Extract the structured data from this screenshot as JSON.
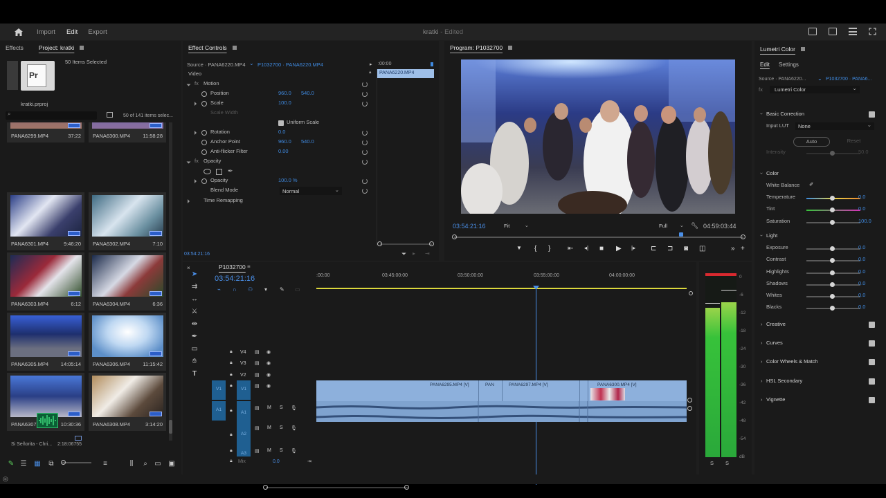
{
  "topbar": {
    "home": "home-icon",
    "nav": [
      "Import",
      "Edit",
      "Export"
    ],
    "active": "Edit",
    "title": "kratki",
    "title_status": "- Edited"
  },
  "project": {
    "tab_effects": "Effects",
    "tab_project": "Project: kratki",
    "selected_info": "50 Items Selected",
    "project_file": "kratki.prproj",
    "items_count": "50 of 141 items selec...",
    "clips": [
      {
        "name": "PANA6299.MP4",
        "dur": "37:22"
      },
      {
        "name": "PANA6300.MP4",
        "dur": "11:58:28"
      },
      {
        "name": "PANA6301.MP4",
        "dur": "9:46:20"
      },
      {
        "name": "PANA6302.MP4",
        "dur": "7:10"
      },
      {
        "name": "PANA6303.MP4",
        "dur": "6:12"
      },
      {
        "name": "PANA6304.MP4",
        "dur": "6:36"
      },
      {
        "name": "PANA6305.MP4",
        "dur": "14:05:14"
      },
      {
        "name": "PANA6306.MP4",
        "dur": "11:15:42"
      },
      {
        "name": "PANA6307.MP4",
        "dur": "10:30:36"
      },
      {
        "name": "PANA6308.MP4",
        "dur": "3:14:20"
      }
    ],
    "audio_clip_name": "Si Señorita - Chri...",
    "audio_clip_dur": "2:18:06755"
  },
  "effect_controls": {
    "tab": "Effect Controls",
    "source": "Source · PANA6220.MP4",
    "sequence": "P1032700 · PANA6220.MP4",
    "time_start": ":00:00",
    "clip_label": "PANA6220.MP4",
    "video_label": "Video",
    "motion": "Motion",
    "position": "Position",
    "position_x": "960.0",
    "position_y": "540.0",
    "scale": "Scale",
    "scale_v": "100.0",
    "scale_width": "Scale Width",
    "uniform_scale": "Uniform Scale",
    "rotation": "Rotation",
    "rotation_v": "0.0",
    "anchor": "Anchor Point",
    "anchor_x": "960.0",
    "anchor_y": "540.0",
    "antiflicker": "Anti-flicker Filter",
    "antiflicker_v": "0.00",
    "opacity_group": "Opacity",
    "opacity": "Opacity",
    "opacity_v": "100.0 %",
    "blend": "Blend Mode",
    "blend_v": "Normal",
    "time_remap": "Time Remapping",
    "timecode": "03:54:21:16"
  },
  "program": {
    "tab": "Program: P1032700",
    "timecode": "03:54:21:16",
    "fit": "Fit",
    "full": "Full",
    "duration": "04:59:03:44"
  },
  "timeline": {
    "tab": "P1032700",
    "timecode": "03:54:21:16",
    "ruler": [
      ":00:00",
      "03:45:00:00",
      "03:50:00:00",
      "03:55:00:00",
      "04:00:00:00"
    ],
    "video_tracks": [
      "V4",
      "V3",
      "V2",
      "V1"
    ],
    "audio_tracks": [
      "A1",
      "A2",
      "A3"
    ],
    "mix": "Mix",
    "mix_v": "0.0",
    "clips": [
      "PANA6295.MP4 [V]",
      "PAN",
      "PANA6297.MP4 [V]",
      "PANA6300.MP4 [V]"
    ]
  },
  "meter": {
    "scale": [
      "0",
      "-6",
      "-12",
      "-18",
      "-24",
      "-30",
      "-36",
      "-42",
      "-48",
      "-54",
      "dB"
    ],
    "solo": [
      "S",
      "S"
    ]
  },
  "lumetri": {
    "tab": "Lumetri Color",
    "tabs": [
      "Edit",
      "Settings"
    ],
    "source": "Source · PANA6220...",
    "sequence": "P1032700 · PANA6...",
    "effect": "Lumetri Color",
    "basic_correction": "Basic Correction",
    "input_lut": "Input LUT",
    "input_lut_v": "None",
    "auto": "Auto",
    "reset": "Reset",
    "intensity": "Intensity",
    "intensity_v": "50.0",
    "color": "Color",
    "white_balance": "White Balance",
    "temperature": "Temperature",
    "temperature_v": "0.0",
    "tint": "Tint",
    "tint_v": "0.0",
    "saturation": "Saturation",
    "saturation_v": "100.0",
    "light": "Light",
    "exposure": "Exposure",
    "exposure_v": "0.0",
    "contrast": "Contrast",
    "contrast_v": "0.0",
    "highlights": "Highlights",
    "highlights_v": "0.0",
    "shadows": "Shadows",
    "shadows_v": "0.0",
    "whites": "Whites",
    "whites_v": "0.0",
    "blacks": "Blacks",
    "blacks_v": "0.0",
    "sections": [
      "Creative",
      "Curves",
      "Color Wheels & Match",
      "HSL Secondary",
      "Vignette"
    ]
  },
  "colors": {
    "accent": "#3f8ae0",
    "clip_video": "#8db0dc",
    "clip_audio": "#7fa3cf",
    "playhead": "#4a8fe8",
    "track_header": "#1f5f91"
  }
}
